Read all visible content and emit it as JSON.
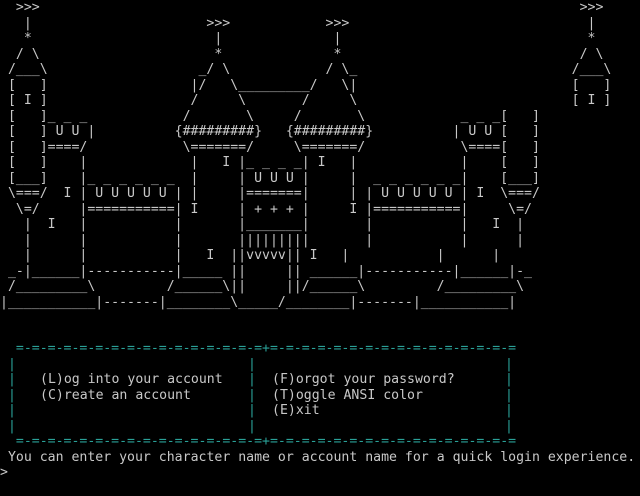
{
  "ascii_art": [
    "  >>>                                                                    >>>",
    "   |                      >>>            >>>                              |",
    "   *                       |              |                               *",
    "  / \\                      *              *                              / \\",
    " /___\\                   _/ \\            / \\_                           /___\\",
    " [   ]                  |/   \\_________/   \\|                           [   ]",
    " [ I ]                  /     \\       /     \\                           [ I ]",
    " [   ]_ _ _            /       \\     /       \\            _ _ _[   ]",
    " [   ] U U |          {#########}   {#########}          | U U [   ]",
    " [   ]====/            \\=======/     \\=======/            \\====[   ]",
    " [   ]    |             |   I |_ _ _ _| I   |             |    [   ]",
    " [___]    |_ _ _ _ _ _  |     | U U U |     |  _ _ _ _ _ _|    [___]",
    " \\===/  I | U U U U U | |     |=======|     | | U U U U U | I  \\===/",
    "  \\=/     |===========| I     | + + + |     I |===========|     \\=/",
    "   |  I   |           |       |_______|       |           |   I  |",
    "   |      |           |       |||||||||       |           |      |",
    "   |      |           |   I  ||vvvvv|| I   |           |      |",
    " _-|______|-----------|_____ ||     || ______|-----------|______|-_",
    " /_________\\         /______\\||     ||/______\\         /_________\\",
    "|___________|-------|________\\_____/________|-------|___________|"
  ],
  "menu": {
    "rule": "=-=-=-=-=-=-=-=-=-=-=-=-=-=-=-=+=-=-=-=-=-=-=-=-=-=-=-=-=-=-=-=",
    "left_items": [
      {
        "key": "L",
        "rest": "og into your account"
      },
      {
        "key": "C",
        "rest": "reate an account"
      }
    ],
    "right_items": [
      {
        "key": "F",
        "rest": "orgot your password?"
      },
      {
        "key": "T",
        "rest": "oggle ANSI color"
      },
      {
        "key": "E",
        "rest": "xit"
      }
    ]
  },
  "hint": "You can enter your character name or account name for a quick login experience.",
  "prompt": ">"
}
